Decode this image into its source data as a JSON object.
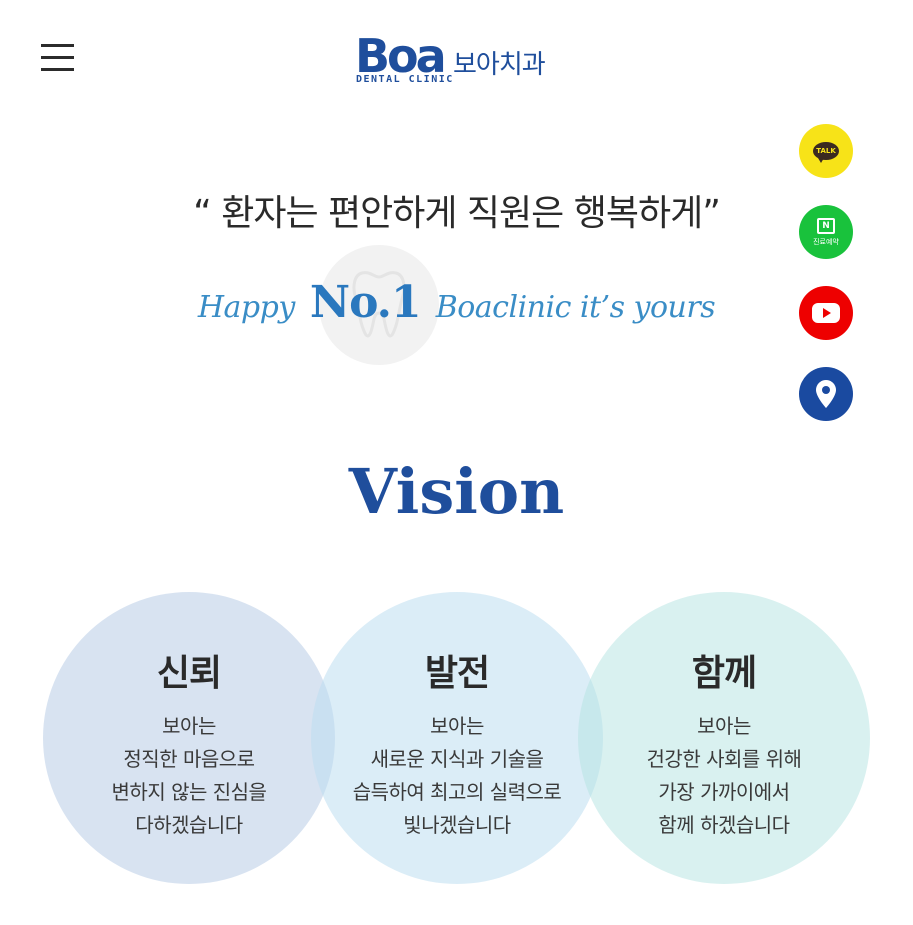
{
  "header": {
    "menu_icon": "hamburger-menu-icon",
    "logo": {
      "mark_text": "Boa",
      "korean_name": "보아치과",
      "subtitle": "DENTAL CLINIC",
      "brand_color": "#1f4e9c"
    }
  },
  "quick_links": [
    {
      "icon": "kakao-talk-icon",
      "text": "TALK",
      "color": "#f7e318"
    },
    {
      "icon": "naver-booking-icon",
      "text": "N",
      "label": "진료예약",
      "color": "#19c23c"
    },
    {
      "icon": "youtube-icon",
      "color": "#ee0000"
    },
    {
      "icon": "map-pin-icon",
      "color": "#1a4aa0"
    }
  ],
  "hero": {
    "slogan": "“ 환자는 편안하게 직원은 행복하게”",
    "tagline_before": "Happy",
    "tagline_highlight": "No.1",
    "tagline_after": "Boaclinic it’s yours",
    "decor_icon": "tooth-icon"
  },
  "vision": {
    "title": "Vision",
    "values": [
      {
        "title": "신뢰",
        "lines": [
          "보아는",
          "정직한 마음으로",
          "변하지 않는 진심을",
          "다하겠습니다"
        ]
      },
      {
        "title": "발전",
        "lines": [
          "보아는",
          "새로운 지식과 기술을",
          "습득하여 최고의 실력으로",
          "빛나겠습니다"
        ]
      },
      {
        "title": "함께",
        "lines": [
          "보아는",
          "건강한 사회를 위해",
          "가장 가까이에서",
          "함께 하겠습니다"
        ]
      }
    ]
  }
}
